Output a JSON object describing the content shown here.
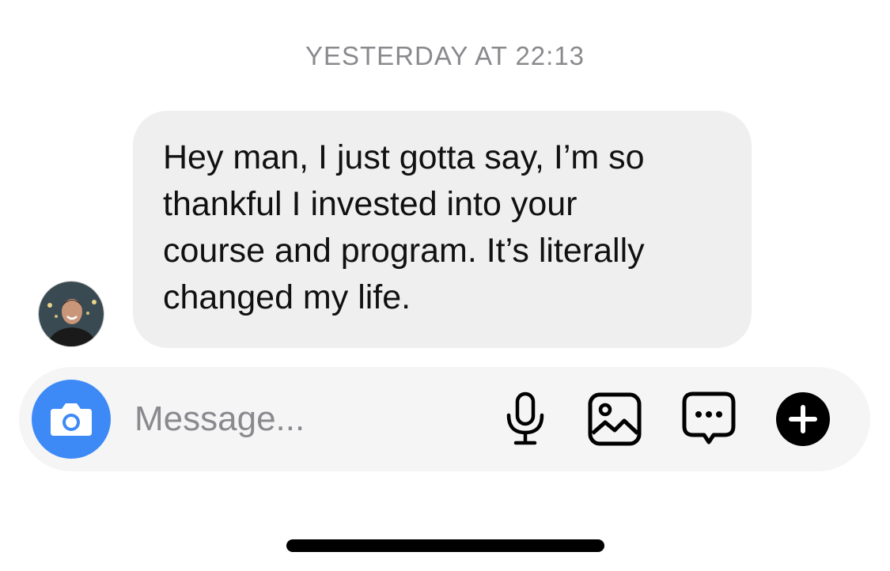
{
  "conversation": {
    "timestamp": "YESTERDAY AT 22:13",
    "message": {
      "lines": [
        "Hey man, I just gotta say, I’m so",
        "thankful I invested into your",
        "course and program. It’s literally",
        "changed my life."
      ]
    }
  },
  "composer": {
    "placeholder": "Message...",
    "icons": {
      "camera": "camera-icon",
      "microphone": "microphone-icon",
      "gallery": "image-icon",
      "sticker": "chat-bubble-icon",
      "add": "plus-icon"
    }
  },
  "colors": {
    "accent": "#3d8af7",
    "bubble": "#efeff0",
    "composer": "#f5f5f6",
    "timestamp": "#8a8a8e"
  }
}
